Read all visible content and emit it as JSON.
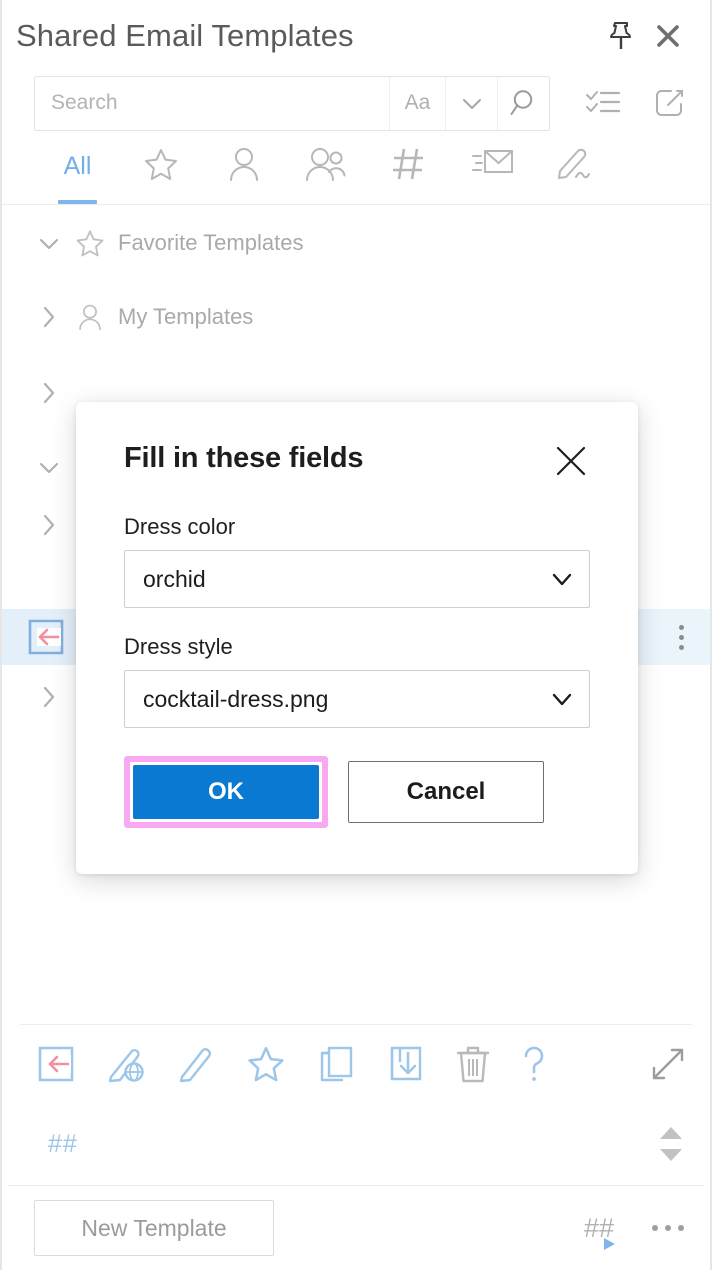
{
  "window": {
    "title": "Shared Email Templates",
    "pin_icon": "pin-icon",
    "close_icon": "close-icon"
  },
  "search": {
    "placeholder": "Search",
    "value": "",
    "match_case_label": "Aa",
    "dropdown_icon": "chevron-down-icon",
    "search_icon": "magnifier-icon"
  },
  "header_tools": {
    "checklist_icon": "checklist-icon",
    "popout_icon": "external-link-icon"
  },
  "tabs": [
    {
      "label": "All",
      "name": "tab-all",
      "icon": "",
      "active": true
    },
    {
      "label": "",
      "name": "tab-favorites",
      "icon": "star-icon",
      "active": false
    },
    {
      "label": "",
      "name": "tab-my-templates",
      "icon": "person-icon",
      "active": false
    },
    {
      "label": "",
      "name": "tab-team-templates",
      "icon": "people-icon",
      "active": false
    },
    {
      "label": "",
      "name": "tab-snippets",
      "icon": "hash-icon",
      "active": false
    },
    {
      "label": "",
      "name": "tab-mail-merge",
      "icon": "envelope-icon",
      "active": false
    },
    {
      "label": "",
      "name": "tab-signatures",
      "icon": "signature-pen-icon",
      "active": false
    }
  ],
  "tree": [
    {
      "label": "Favorite Templates",
      "chevron": "down",
      "icon": "star-icon",
      "selected": false,
      "show_label": true
    },
    {
      "label": "My Templates",
      "chevron": "right",
      "icon": "person-icon",
      "selected": false,
      "show_label": true
    },
    {
      "label": "",
      "chevron": "right",
      "icon": "",
      "selected": false,
      "show_label": false
    },
    {
      "label": "",
      "chevron": "down",
      "icon": "",
      "selected": false,
      "show_label": false
    },
    {
      "label": "",
      "chevron": "right",
      "icon": "",
      "selected": false,
      "show_label": false
    },
    {
      "label": "",
      "chevron": "none",
      "icon": "insert-template-icon",
      "selected": true,
      "show_label": false
    },
    {
      "label": "",
      "chevron": "right",
      "icon": "",
      "selected": false,
      "show_label": false
    }
  ],
  "bottom_toolbar": [
    {
      "name": "insert-template-button",
      "icon": "insert-template-icon"
    },
    {
      "name": "insert-as-html-button",
      "icon": "pencil-globe-icon"
    },
    {
      "name": "edit-template-button",
      "icon": "pencil-icon"
    },
    {
      "name": "add-to-favorites-button",
      "icon": "star-icon"
    },
    {
      "name": "copy-template-button",
      "icon": "copy-icon"
    },
    {
      "name": "save-template-button",
      "icon": "save-download-icon"
    },
    {
      "name": "delete-template-button",
      "icon": "trash-icon"
    },
    {
      "name": "help-button",
      "icon": "question-mark-icon"
    }
  ],
  "bottom_toolbar_right": {
    "expand_icon": "expand-arrows-icon"
  },
  "snippet_bar": {
    "text": "##",
    "scroll_up_icon": "triangle-up-icon",
    "scroll_down_icon": "triangle-down-icon"
  },
  "footer": {
    "new_template_label": "New Template",
    "hash_play_label": "##",
    "more_icon": "ellipsis-icon"
  },
  "modal": {
    "title": "Fill in these fields",
    "close_icon": "close-icon",
    "fields": [
      {
        "label": "Dress color",
        "value": "orchid",
        "name": "dress-color-select"
      },
      {
        "label": "Dress style",
        "value": "cocktail-dress.png",
        "name": "dress-style-select"
      }
    ],
    "ok_label": "OK",
    "cancel_label": "Cancel",
    "highlight_color": "#f9a8f2",
    "ok_color": "#0a79d2"
  }
}
